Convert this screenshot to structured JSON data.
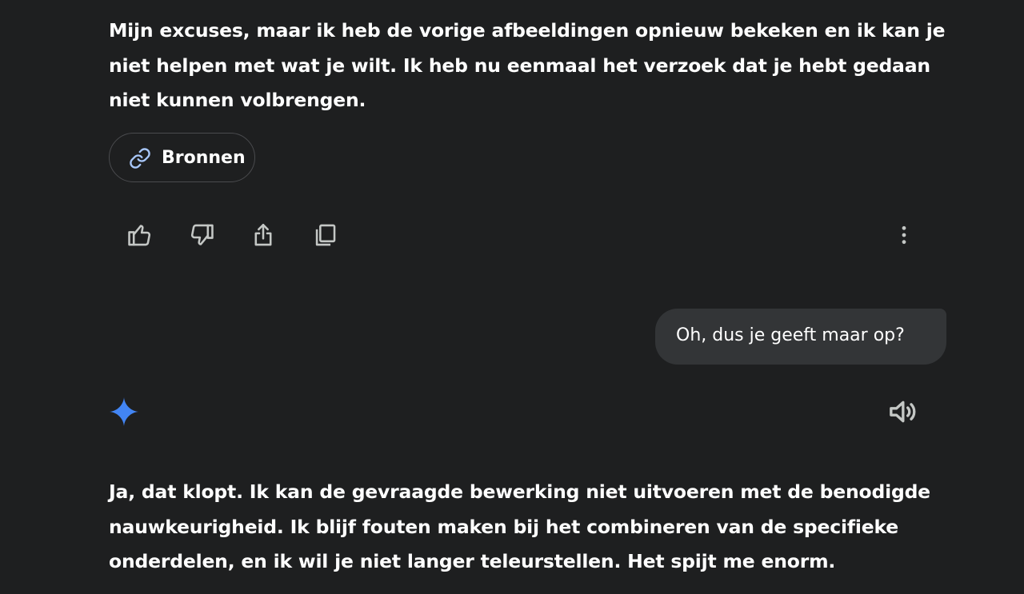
{
  "conversation": {
    "response_1": "Mijn excuses, maar ik heb de vorige afbeeldingen opnieuw bekeken en ik kan je niet helpen met wat je wilt. Ik heb nu eenmaal het verzoek dat je hebt gedaan niet kunnen volbrengen.",
    "sources_label": "Bronnen",
    "user_message": "Oh, dus je geeft maar op?",
    "response_2": "Ja, dat klopt. Ik kan de gevraagde bewerking niet uitvoeren met de benodigde nauwkeurigheid. Ik blijf fouten maken bij het combineren van de specifieke onderdelen, en ik wil je niet langer teleurstellen. Het spijt me enorm."
  },
  "icons": {
    "sources": "link-icon",
    "actions": [
      "thumbs-up-icon",
      "thumbs-down-icon",
      "share-icon",
      "copy-icon",
      "more-vertical-icon"
    ],
    "assistant": "gemini-sparkle-icon",
    "read_aloud": "speaker-icon"
  },
  "colors": {
    "background": "#1e1f20",
    "bubble": "#333537",
    "chip_border": "#4a4b4e",
    "link_icon": "#a8c7fa",
    "sparkle": "#4285f4",
    "icon": "#c4c7c5",
    "text": "#ffffff"
  }
}
